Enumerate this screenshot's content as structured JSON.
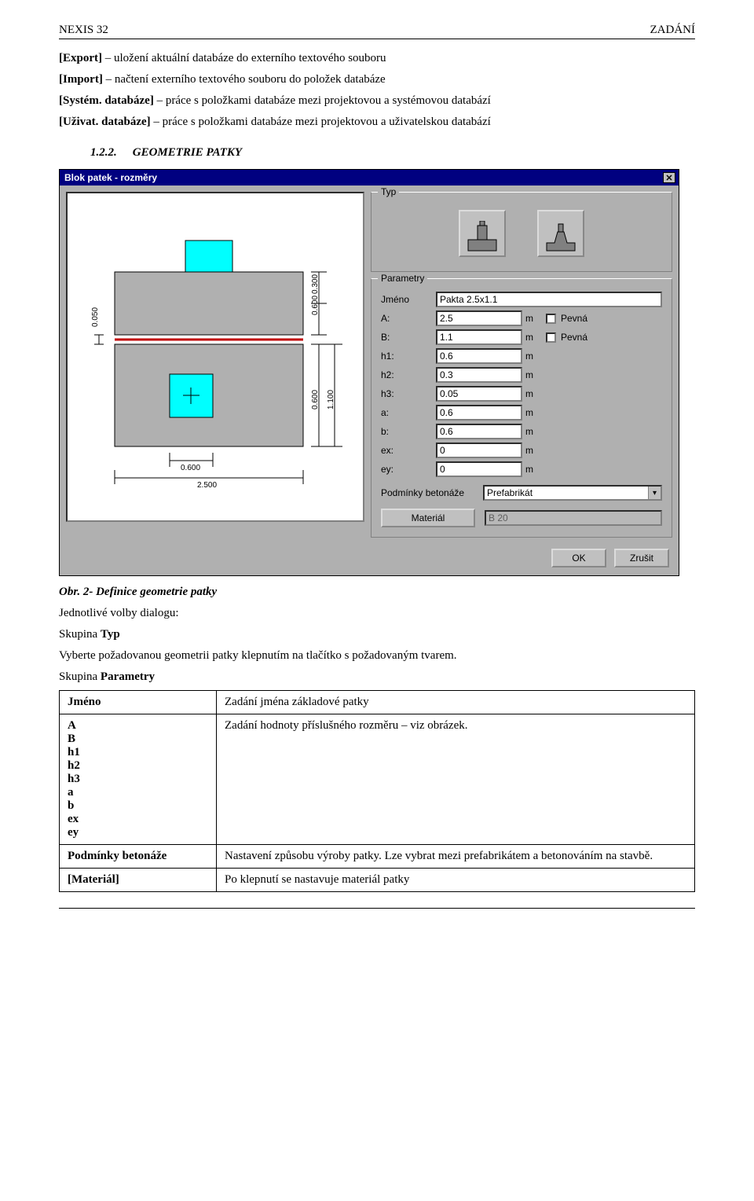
{
  "header": {
    "left": "NEXIS 32",
    "right": "ZADÁNÍ"
  },
  "intro": {
    "line1_bold": "[Export]",
    "line1_rest": " – uložení aktuální databáze do externího textového souboru",
    "line2_bold": "[Import]",
    "line2_rest": " – načtení externího textového souboru do položek databáze",
    "line3_bold": "[Systém. databáze]",
    "line3_rest": " – práce s položkami databáze mezi projektovou a systémovou databází",
    "line4_bold": "[Uživat. databáze]",
    "line4_rest": " – práce s položkami databáze mezi projektovou a uživatelskou databází"
  },
  "section": {
    "num": "1.2.2.",
    "title": "GEOMETRIE PATKY"
  },
  "dialog": {
    "title": "Blok patek - rozměry",
    "grp_typ": "Typ",
    "grp_params": "Parametry",
    "labels": {
      "jmeno": "Jméno",
      "A": "A:",
      "B": "B:",
      "h1": "h1:",
      "h2": "h2:",
      "h3": "h3:",
      "a": "a:",
      "b": "b:",
      "ex": "ex:",
      "ey": "ey:",
      "unit": "m",
      "pevna": "Pevná",
      "podm": "Podmínky betonáže",
      "material_btn": "Materiál",
      "ok": "OK",
      "zrusit": "Zrušit"
    },
    "values": {
      "jmeno": "Pakta 2.5x1.1",
      "A": "2.5",
      "B": "1.1",
      "h1": "0.6",
      "h2": "0.3",
      "h3": "0.05",
      "a": "0.6",
      "b": "0.6",
      "ex": "0",
      "ey": "0",
      "podm": "Prefabrikát",
      "material": "B 20"
    },
    "preview_dims": {
      "d050": "0.050",
      "d0600a": "0.600",
      "d0300": "0.300",
      "d0600b": "0.600",
      "d1100": "1.100",
      "d0600c": "0.600",
      "d2500": "2.500"
    }
  },
  "caption": "Obr. 2- Definice geometrie patky",
  "dlg_lead": "Jednotlivé volby dialogu:",
  "body": {
    "typ_h": "Skupina Typ",
    "typ_bold": "Typ",
    "typ_p": "Vyberte požadovanou geometrii patky klepnutím na tlačítko s požadovaným tvarem.",
    "par_h": "Skupina Parametry",
    "par_bold": "Parametry"
  },
  "table": {
    "rows": [
      {
        "k": "Jméno",
        "v": "Zadání jména základové patky"
      },
      {
        "k": "A\nB\nh1\nh2\nh3\na\nb\nex\ney",
        "v": "Zadání hodnoty příslušného rozměru – viz obrázek."
      },
      {
        "k": "Podmínky betonáže",
        "v": "Nastavení způsobu výroby patky. Lze vybrat mezi prefabrikátem a betonováním na stavbě."
      },
      {
        "k": "[Materiál]",
        "v": "Po klepnutí se nastavuje materiál patky"
      }
    ]
  }
}
